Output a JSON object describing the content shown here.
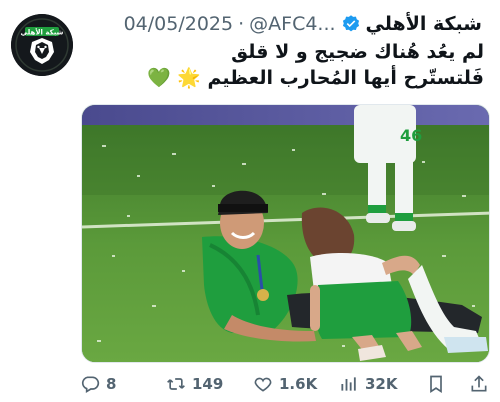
{
  "tweet": {
    "display_name": "شبكة الأهلي",
    "handle": "@AFC4...",
    "separator": "·",
    "date": "04/05/2025",
    "text_line_1": "لم يعُد هُناك ضجيج و لا قلق",
    "text_line_2": "فَلتستّرح أيها المُحارب العظيم 🌟 💚",
    "avatar_label": "شبكة الأهلي"
  },
  "actions": {
    "replies": "8",
    "retweets": "149",
    "likes": "1.6K",
    "views": "32K"
  },
  "photo": {
    "jersey_number": "46"
  },
  "colors": {
    "verified_blue": "#1d9bf0",
    "muted_text": "#536471",
    "pitch_green": "#4f8a32",
    "jersey_green": "#1f9e3e"
  }
}
